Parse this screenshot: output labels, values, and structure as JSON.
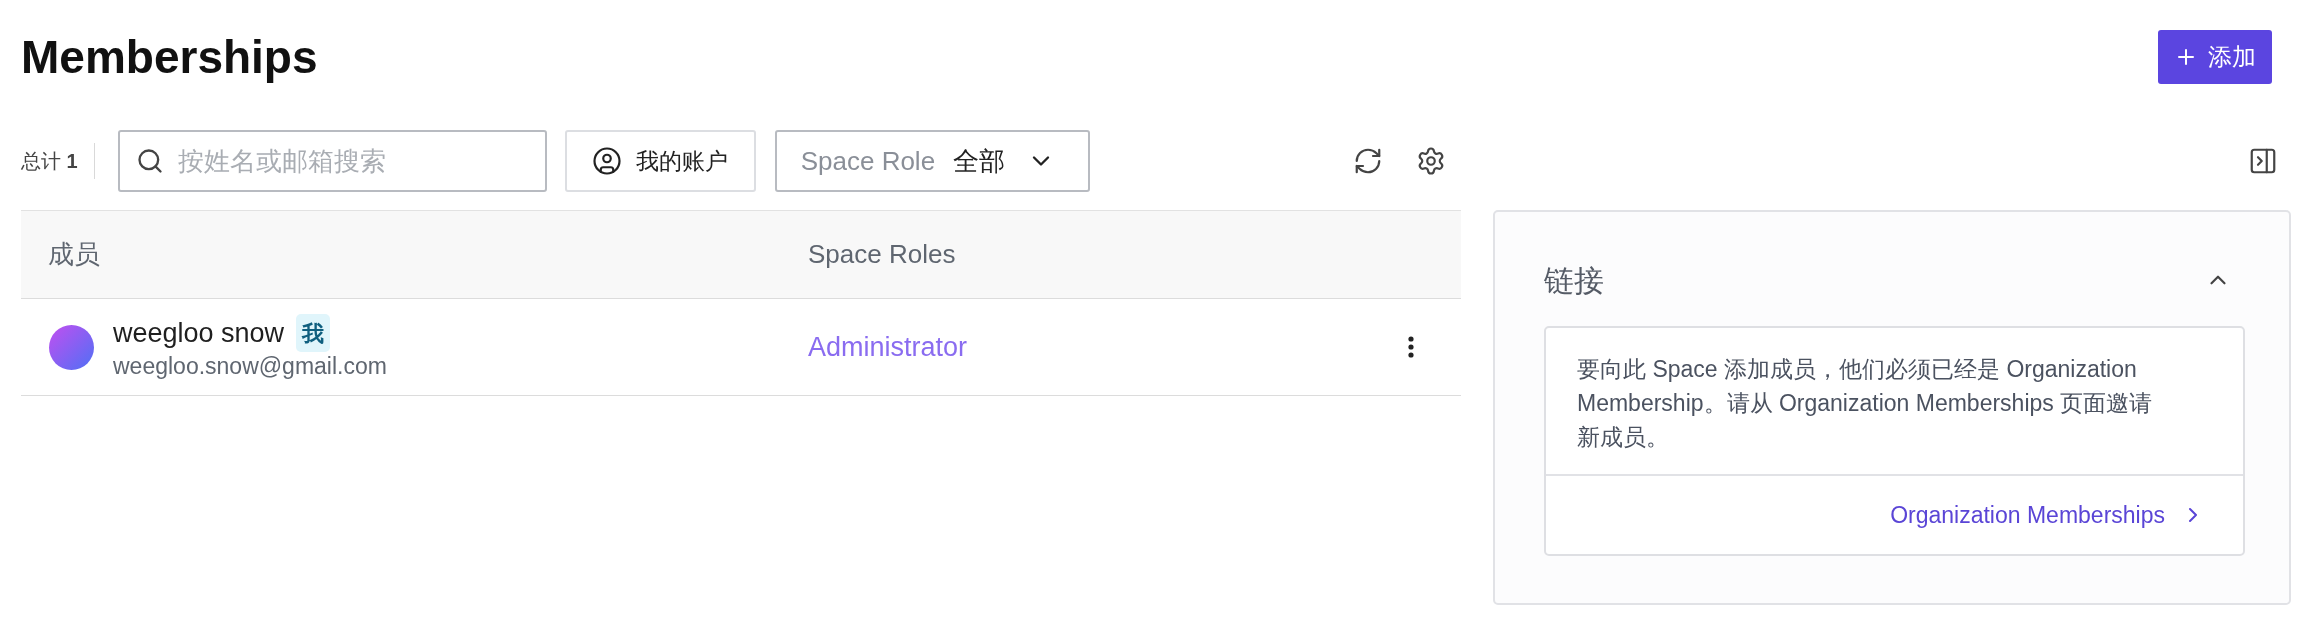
{
  "page": {
    "title": "Memberships",
    "add_button": {
      "label": "添加"
    }
  },
  "toolbar": {
    "total": "总计 **1**",
    "search": {
      "placeholder": "按姓名或邮箱搜索"
    },
    "my_account_button": {
      "label": "我的账户"
    },
    "role_filter": {
      "label": "Space Role",
      "value": "全部"
    }
  },
  "table": {
    "columns": [
      "成员",
      "Space Roles"
    ],
    "rows": [
      {
        "name": "weegloo snow",
        "tag": "我",
        "email": "weegloo.snow@gmail.com",
        "role": "Administrator"
      }
    ]
  },
  "links_panel": {
    "title": "链接",
    "expanded": true,
    "message": "要向此 Space 添加成员，他们必须已经是 Organization Membership。请从 Organization Memberships 页面邀请新成员。",
    "link": "Organization Memberships"
  }
}
